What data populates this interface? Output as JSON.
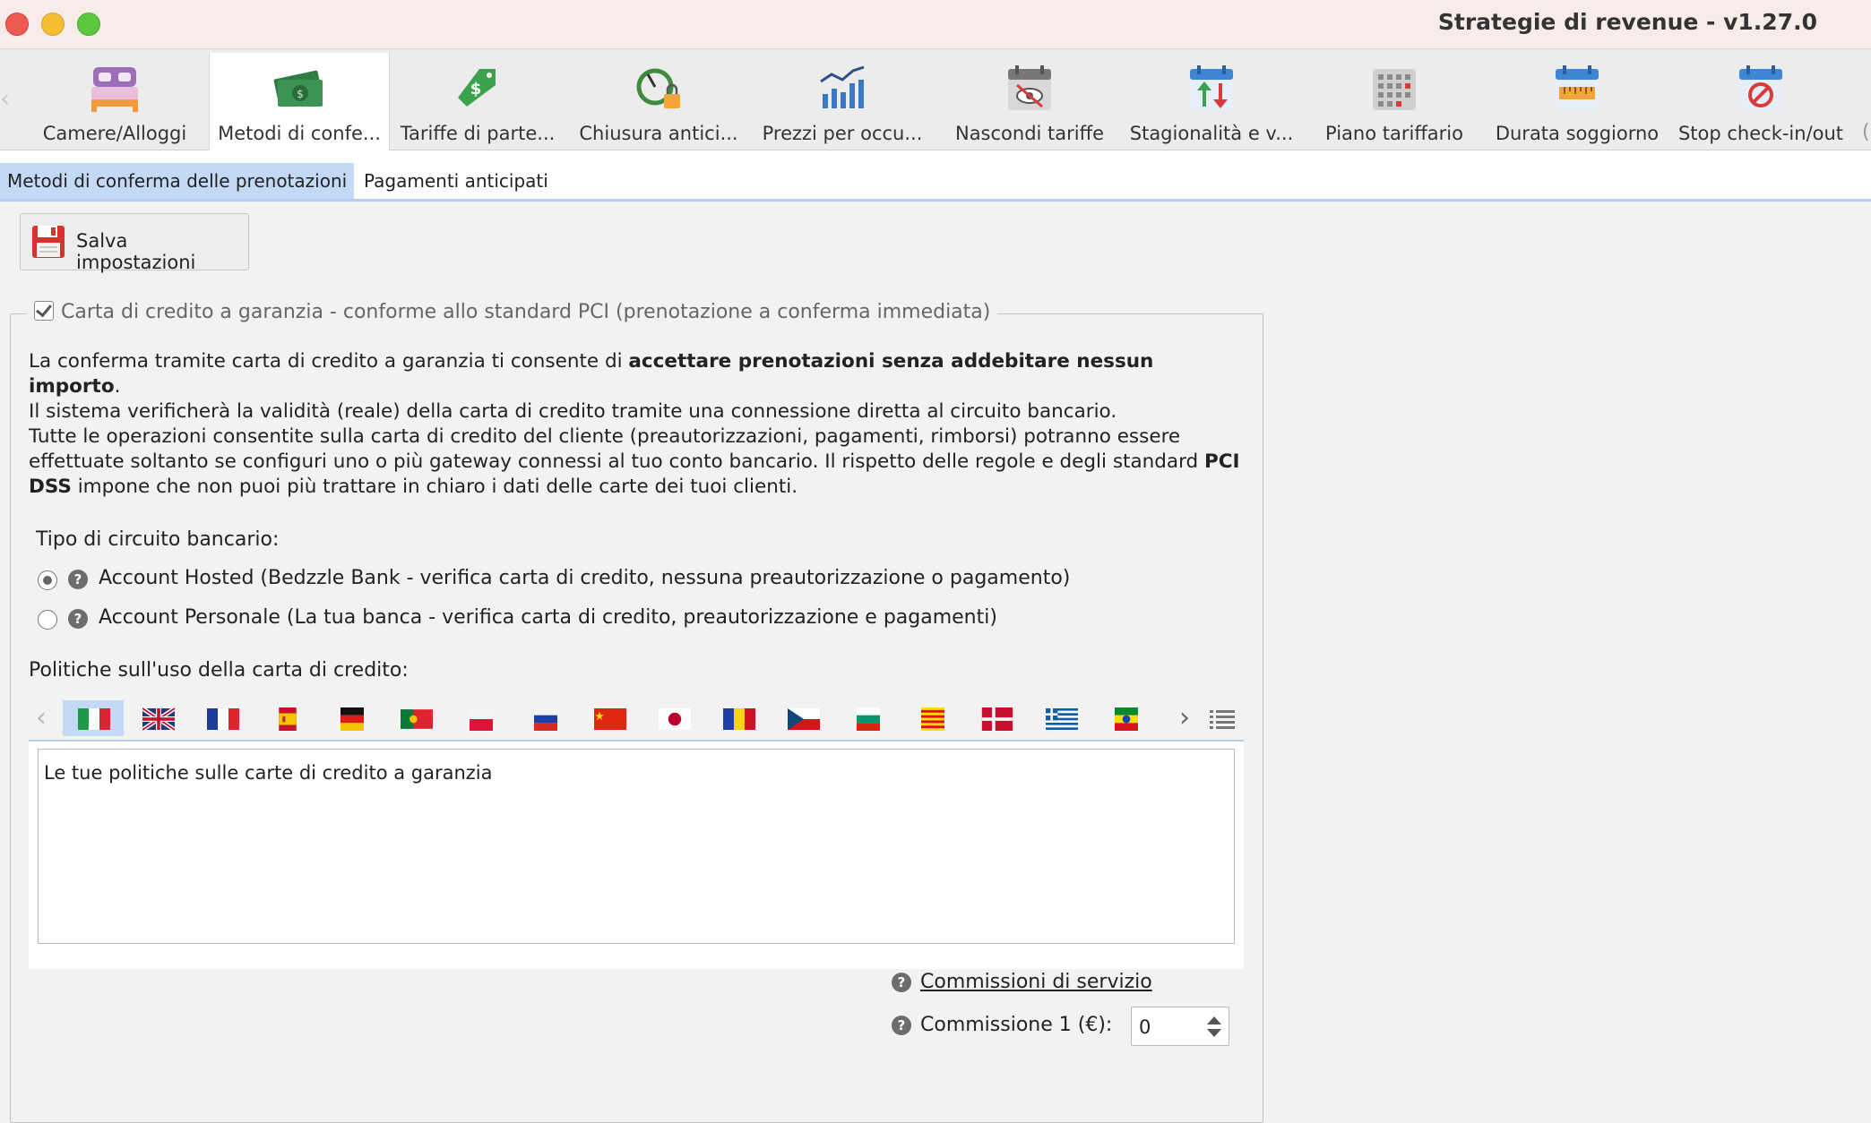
{
  "window": {
    "title": "Strategie di revenue - v1.27.0"
  },
  "toolbar": {
    "items": [
      {
        "label": "Camere/Alloggi",
        "icon": "bed-icon"
      },
      {
        "label": "Metodi di confe...",
        "icon": "money-icon"
      },
      {
        "label": "Tariffe di parte...",
        "icon": "price-tag-icon"
      },
      {
        "label": "Chiusura antici...",
        "icon": "timer-lock-icon"
      },
      {
        "label": "Prezzi per occu...",
        "icon": "bar-chart-icon"
      },
      {
        "label": "Nascondi tariffe",
        "icon": "hidden-eye-calendar-icon"
      },
      {
        "label": "Stagionalità e v...",
        "icon": "up-down-calendar-icon"
      },
      {
        "label": "Piano tariffario",
        "icon": "grid-calendar-icon"
      },
      {
        "label": "Durata soggiorno",
        "icon": "ruler-calendar-icon"
      },
      {
        "label": "Stop check-in/out",
        "icon": "stop-calendar-icon"
      }
    ],
    "active_index": 1
  },
  "subtabs": [
    {
      "label": "Metodi di conferma delle prenotazioni",
      "active": true
    },
    {
      "label": "Pagamenti anticipati",
      "active": false
    }
  ],
  "save_button": {
    "label": "Salva impostazioni"
  },
  "group": {
    "legend": "Carta di credito a garanzia - conforme allo standard PCI (prenotazione a conferma immediata)",
    "checked": true,
    "p1_line1_before": "La conferma tramite carta di credito a garanzia ti consente di ",
    "p1_line1_bold": "accettare prenotazioni senza addebitare nessun importo",
    "p1_line1_after": ".",
    "p1_line2": "Il sistema verificherà la validità (reale) della carta di credito tramite una connessione diretta al circuito bancario.",
    "p2_before": "Tutte le operazioni consentite sulla carta di credito del cliente (preautorizzazioni, pagamenti, rimborsi) potranno essere effettuate soltanto se configuri uno o più gateway connessi al tuo conto bancario. Il rispetto delle regole e degli standard ",
    "p2_bold": "PCI DSS",
    "p2_after": " impone che non puoi più trattare in chiaro i dati delle carte dei tuoi clienti.",
    "circuit_label": "Tipo di circuito bancario:",
    "radio_options": [
      {
        "label": "Account Hosted (Bedzzle Bank - verifica carta di credito, nessuna preautorizzazione o pagamento)",
        "checked": true
      },
      {
        "label": "Account Personale (La tua banca - verifica carta di credito, preautorizzazione e pagamenti)",
        "checked": false
      }
    ],
    "policies_label": "Politiche sull'uso della carta di credito:",
    "flags": [
      "it",
      "gb",
      "fr",
      "es",
      "de",
      "pt",
      "pl",
      "ru",
      "cn",
      "jp",
      "ro",
      "cz",
      "bg",
      "ca",
      "dk",
      "gr",
      "et"
    ],
    "active_flag_index": 0,
    "textarea_value": "Le tue politiche sulle carte di credito a garanzia",
    "fees_link": "Commissioni di servizio",
    "fee1_label": "Commissione 1 (€):",
    "fee1_value": "0"
  },
  "colors": {
    "accent_tab": "#c4d9f5",
    "tab_underline": "#b7cfef"
  }
}
